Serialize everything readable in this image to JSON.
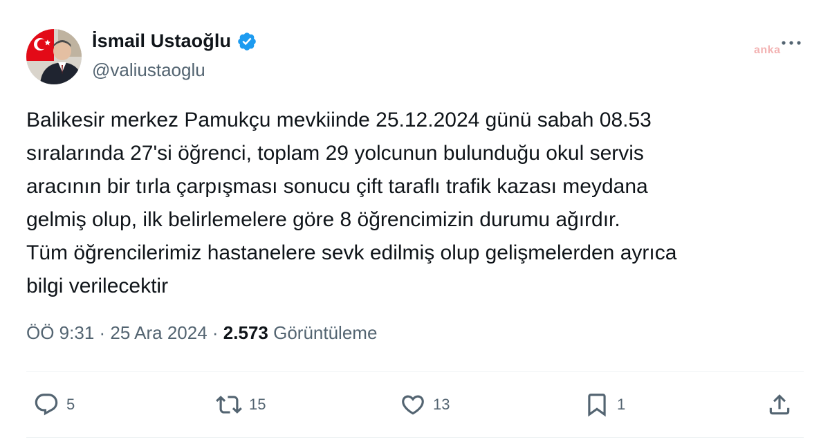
{
  "author": {
    "name": "İsmail Ustaoğlu",
    "handle": "@valiustaoglu",
    "verified": true,
    "verified_color": "#1d9bf0"
  },
  "watermark": "anka",
  "tweet": {
    "lines": [
      "Balikesir merkez Pamukçu mevkiinde 25.12.2024 günü sabah 08.53",
      "sıralarında 27'si öğrenci, toplam 29 yolcunun bulunduğu okul servis",
      "aracının bir tırla çarpışması sonucu çift taraflı trafik kazası meydana",
      "gelmiş olup, ilk belirlemelere göre 8 öğrencimizin durumu ağırdır.",
      "Tüm öğrencilerimiz hastanelere sevk edilmiş olup gelişmelerden ayrıca",
      "bilgi verilecektir"
    ]
  },
  "meta": {
    "time": "ÖÖ 9:31",
    "date": "25 Ara 2024",
    "separator": "·",
    "views_count": "2.573",
    "views_label": "Görüntüleme"
  },
  "actions": {
    "replies": "5",
    "reposts": "15",
    "likes": "13",
    "bookmarks": "1"
  },
  "icons": {
    "reply": "speech-bubble-icon",
    "repost": "repost-arrows-icon",
    "like": "heart-icon",
    "bookmark": "bookmark-icon",
    "share": "share-icon",
    "more": "more-dots-icon",
    "verified": "verified-badge-icon"
  },
  "colors": {
    "text": "#0f1419",
    "secondary": "#536471",
    "accent": "#1d9bf0"
  }
}
